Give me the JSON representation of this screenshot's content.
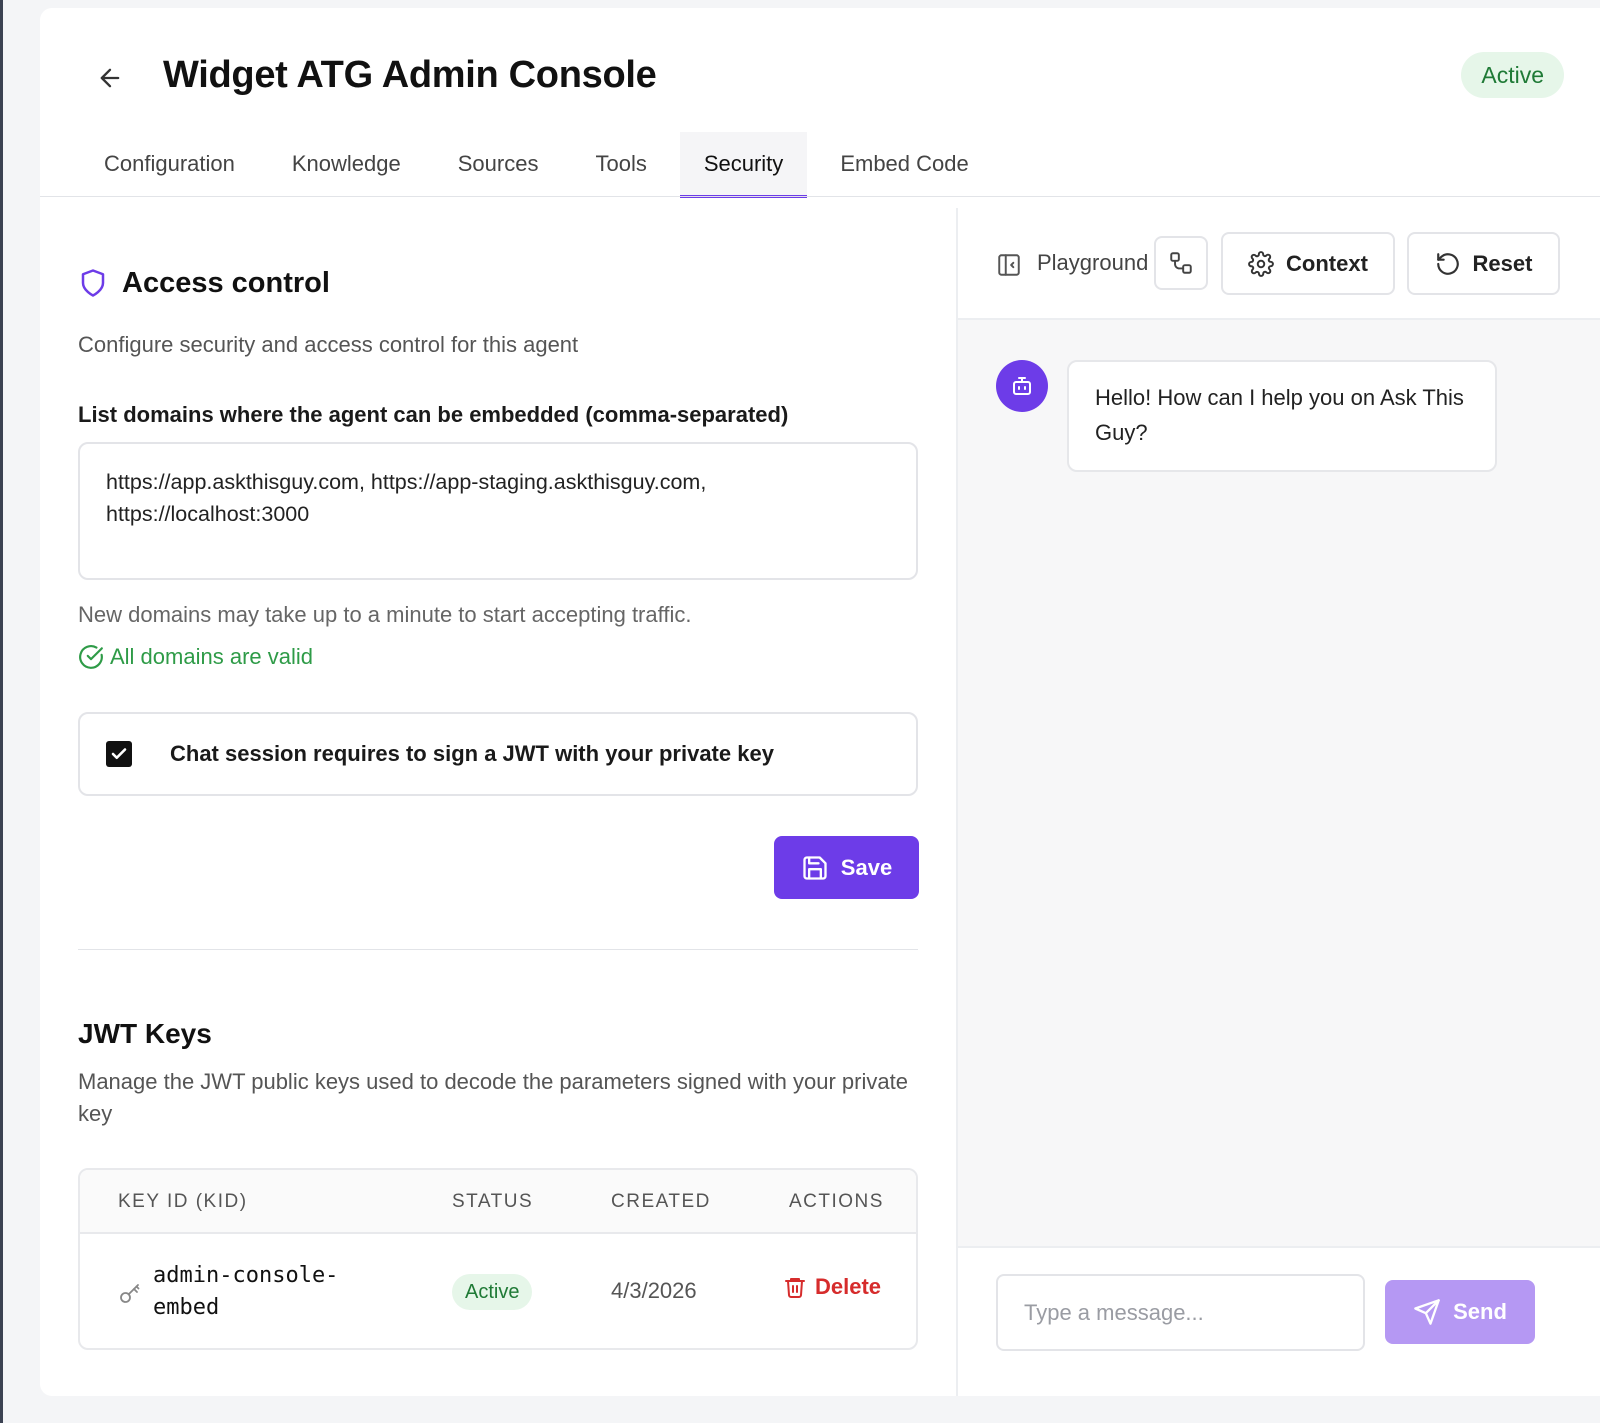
{
  "header": {
    "title": "Widget ATG Admin Console",
    "status": "Active"
  },
  "tabs": [
    {
      "label": "Configuration",
      "active": false
    },
    {
      "label": "Knowledge",
      "active": false
    },
    {
      "label": "Sources",
      "active": false
    },
    {
      "label": "Tools",
      "active": false
    },
    {
      "label": "Security",
      "active": true
    },
    {
      "label": "Embed Code",
      "active": false
    }
  ],
  "access_control": {
    "title": "Access control",
    "subtitle": "Configure security and access control for this agent",
    "domains_label": "List domains where the agent can be embedded (comma-separated)",
    "domains_value": "https://app.askthisguy.com, https://app-staging.askthisguy.com, https://localhost:3000",
    "hint": "New domains may take up to a minute to start accepting traffic.",
    "validation": "All domains are valid",
    "jwt_required_label": "Chat session requires to sign a JWT with your private key",
    "jwt_required_checked": true,
    "save_label": "Save"
  },
  "jwt_keys": {
    "title": "JWT Keys",
    "subtitle": "Manage the JWT public keys used to decode the parameters signed with your private key",
    "columns": [
      "KEY ID (KID)",
      "STATUS",
      "CREATED",
      "ACTIONS"
    ],
    "rows": [
      {
        "kid": "admin-console-embed",
        "status": "Active",
        "created": "4/3/2026",
        "action": "Delete"
      }
    ]
  },
  "playground": {
    "label": "Playground",
    "context_label": "Context",
    "reset_label": "Reset",
    "bot_message": "Hello! How can I help you on Ask This Guy?",
    "input_placeholder": "Type a message...",
    "send_label": "Send"
  },
  "icons": {
    "back": "arrow-left-icon",
    "shield": "shield-icon",
    "valid": "check-circle-icon",
    "save": "floppy-disk-icon",
    "key": "key-icon",
    "delete": "trash-icon",
    "panel": "panel-collapse-icon",
    "swap": "route-icon",
    "context": "gear-icon",
    "reset": "rotate-ccw-icon",
    "bot": "bot-icon",
    "send": "send-icon"
  },
  "colors": {
    "accent": "#6d3ce8",
    "success": "#2e9b47",
    "danger": "#d62c2c",
    "send_disabled": "#b598f3"
  }
}
